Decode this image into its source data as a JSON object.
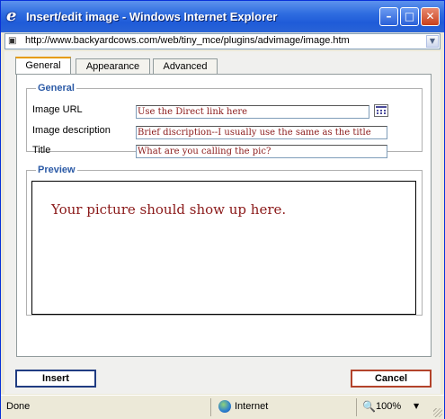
{
  "window": {
    "title": "Insert/edit image - Windows Internet Explorer",
    "controls": {
      "minimize": "–",
      "maximize": "□",
      "close": "✕"
    }
  },
  "address_bar": {
    "url": "http://www.backyardcows.com/web/tiny_mce/plugins/advimage/image.htm"
  },
  "tabs": [
    {
      "label": "General",
      "active": true
    },
    {
      "label": "Appearance",
      "active": false
    },
    {
      "label": "Advanced",
      "active": false
    }
  ],
  "general": {
    "legend": "General",
    "image_url_label": "Image URL",
    "image_url_value": "Use the Direct link here",
    "description_label": "Image description",
    "description_value": "Brief discription--I usually use the same as the title",
    "title_label": "Title",
    "title_value": "What are you calling the pic?"
  },
  "preview": {
    "legend": "Preview",
    "text": "Your picture should show up here."
  },
  "buttons": {
    "insert": "Insert",
    "cancel": "Cancel"
  },
  "status_bar": {
    "status": "Done",
    "zone": "Internet",
    "zoom": "100%"
  },
  "colors": {
    "titlebar": "#2f6de0",
    "accent_tab": "#e69b00",
    "legend": "#2b5aa6",
    "input_text": "#8b1a1a"
  },
  "icons": [
    "ie-logo-icon",
    "page-icon",
    "browse-icon",
    "globe-icon",
    "zoom-icon"
  ]
}
